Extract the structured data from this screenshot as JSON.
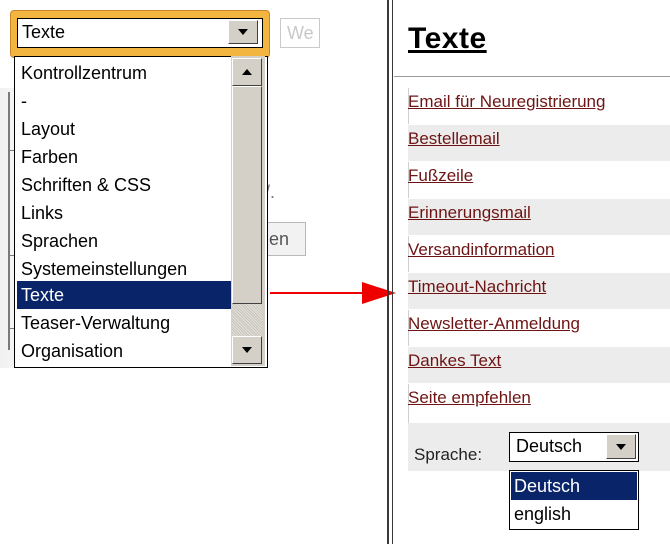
{
  "left_panel": {
    "combo_value": "Texte",
    "faded_field_text": "We",
    "ghost_button_text": "en",
    "ghost_text_dot": "/.",
    "dropdown_items": [
      "Kontrollzentrum",
      "-",
      "Layout",
      "Farben",
      "Schriften & CSS",
      "Links",
      "Sprachen",
      "Systemeinstellungen",
      "Texte",
      "Teaser-Verwaltung",
      "Organisation"
    ],
    "selected_item": "Texte"
  },
  "arrow": {
    "color": "#ee0000"
  },
  "right_panel": {
    "title": "Texte",
    "links": [
      "Email für Neuregistrierung",
      "Bestellemail",
      "Fußzeile",
      "Erinnerungsmail",
      "Versandinformation",
      "Timeout-Nachricht",
      "Newsletter-Anmeldung",
      "Dankes Text",
      "Seite empfehlen"
    ],
    "language_label": "Sprache:",
    "language_value": "Deutsch",
    "language_options": [
      "Deutsch",
      "english"
    ],
    "language_selected": "Deutsch"
  },
  "colors": {
    "selection": "#0a246a",
    "link": "#6e1414",
    "focus_frame": "#f2b640"
  },
  "icons": {
    "dropdown_arrow": "chevron-down-icon",
    "scroll_up": "scroll-up-arrow-icon",
    "scroll_down": "scroll-down-arrow-icon",
    "pointer_arrow": "red-arrow-icon"
  }
}
